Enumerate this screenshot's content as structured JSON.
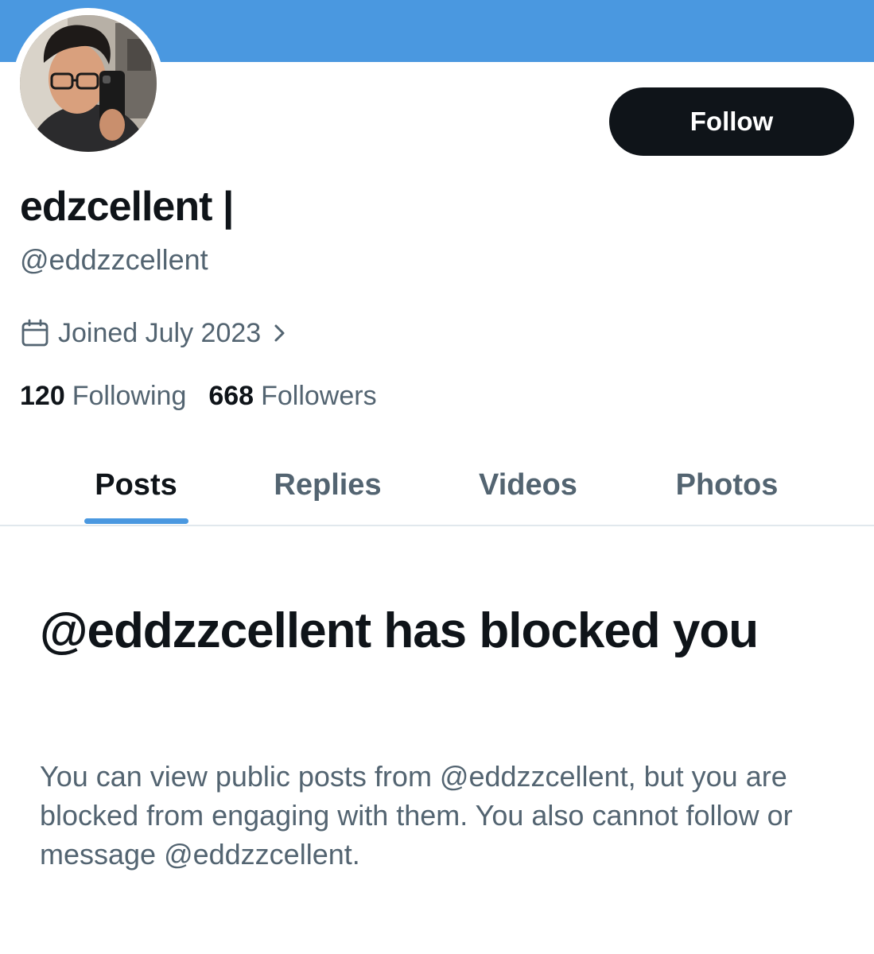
{
  "profile": {
    "display_name": "edzcellent |",
    "handle": "@eddzzcellent",
    "joined": "Joined July 2023",
    "following_count": "120",
    "following_label": "Following",
    "followers_count": "668",
    "followers_label": "Followers",
    "follow_label": "Follow"
  },
  "tabs": [
    {
      "label": "Posts",
      "active": true
    },
    {
      "label": "Replies",
      "active": false
    },
    {
      "label": "Videos",
      "active": false
    },
    {
      "label": "Photos",
      "active": false
    }
  ],
  "blocked": {
    "title": "@eddzzcellent has blocked you",
    "description": "You can view public posts from @eddzzcellent, but you are blocked from engaging with them. You also cannot follow or message @eddzzcellent."
  },
  "icons": {
    "joined": "calendar-icon",
    "joined_more": "chevron-right-icon"
  },
  "colors": {
    "banner": "#4a98e0",
    "accent": "#4a98e0",
    "primary_text": "#0f1419",
    "secondary_text": "#536471",
    "button_bg": "#0f1419"
  }
}
